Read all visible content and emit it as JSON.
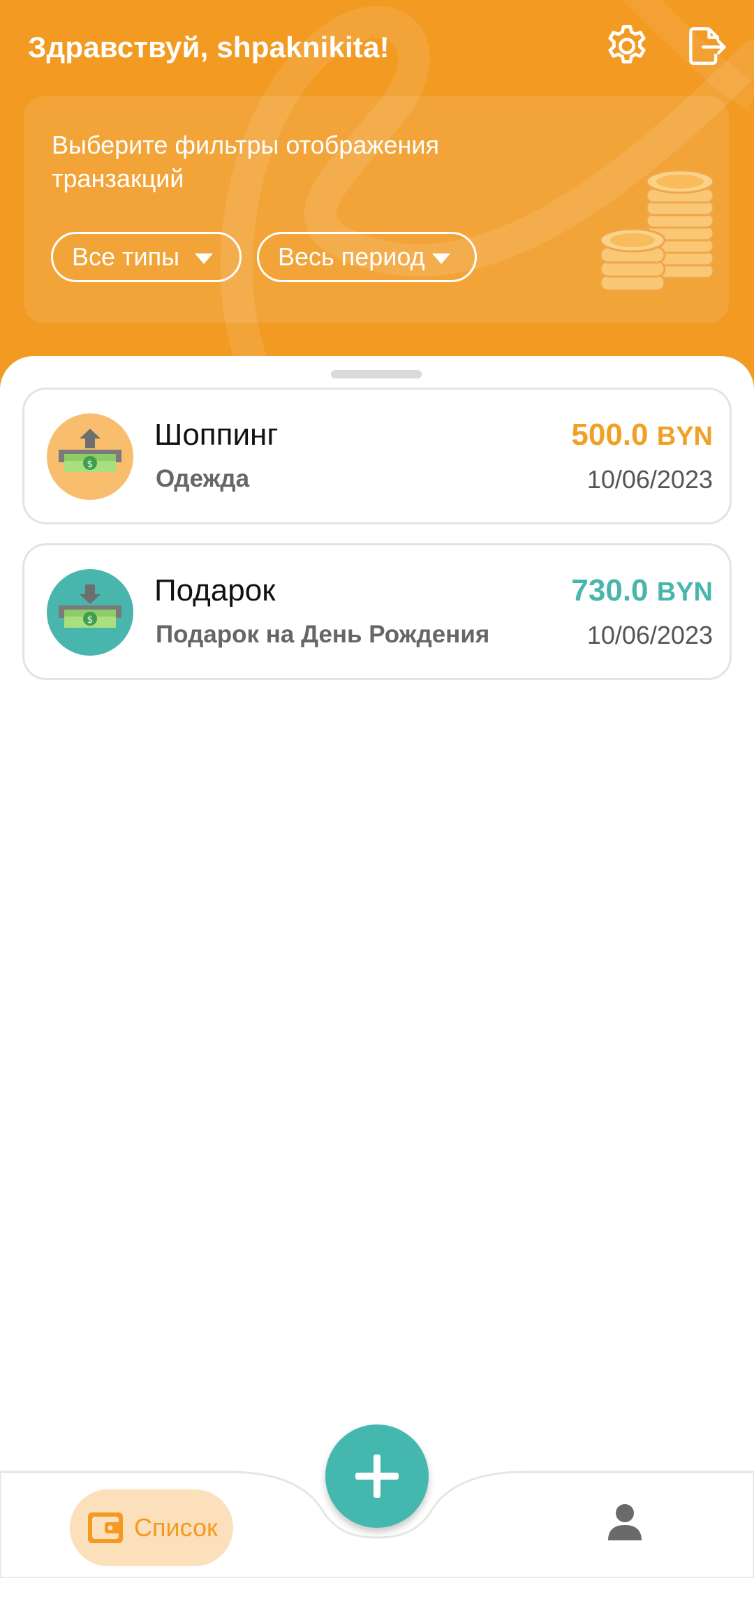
{
  "header": {
    "greeting": "Здравствуй, shpaknikita!",
    "settings_icon": "gear-icon",
    "logout_icon": "logout-icon"
  },
  "filters": {
    "title": "Выберите фильтры отображения транзакций",
    "type_filter": "Все типы",
    "period_filter": "Весь период"
  },
  "transactions": [
    {
      "title": "Шоппинг",
      "note": "Одежда",
      "amount": "500.0",
      "currency": "BYN",
      "date": "10/06/2023",
      "kind": "expense",
      "color": "#F0A024"
    },
    {
      "title": "Подарок",
      "note": "Подарок на День Рождения",
      "amount": "730.0",
      "currency": "BYN",
      "date": "10/06/2023",
      "kind": "income",
      "color": "#48B6AC"
    }
  ],
  "nav": {
    "list_label": "Список",
    "add_icon": "plus-icon",
    "profile_icon": "person-icon"
  },
  "colors": {
    "brand_orange": "#F29A22",
    "accent_teal": "#44B8AE"
  }
}
